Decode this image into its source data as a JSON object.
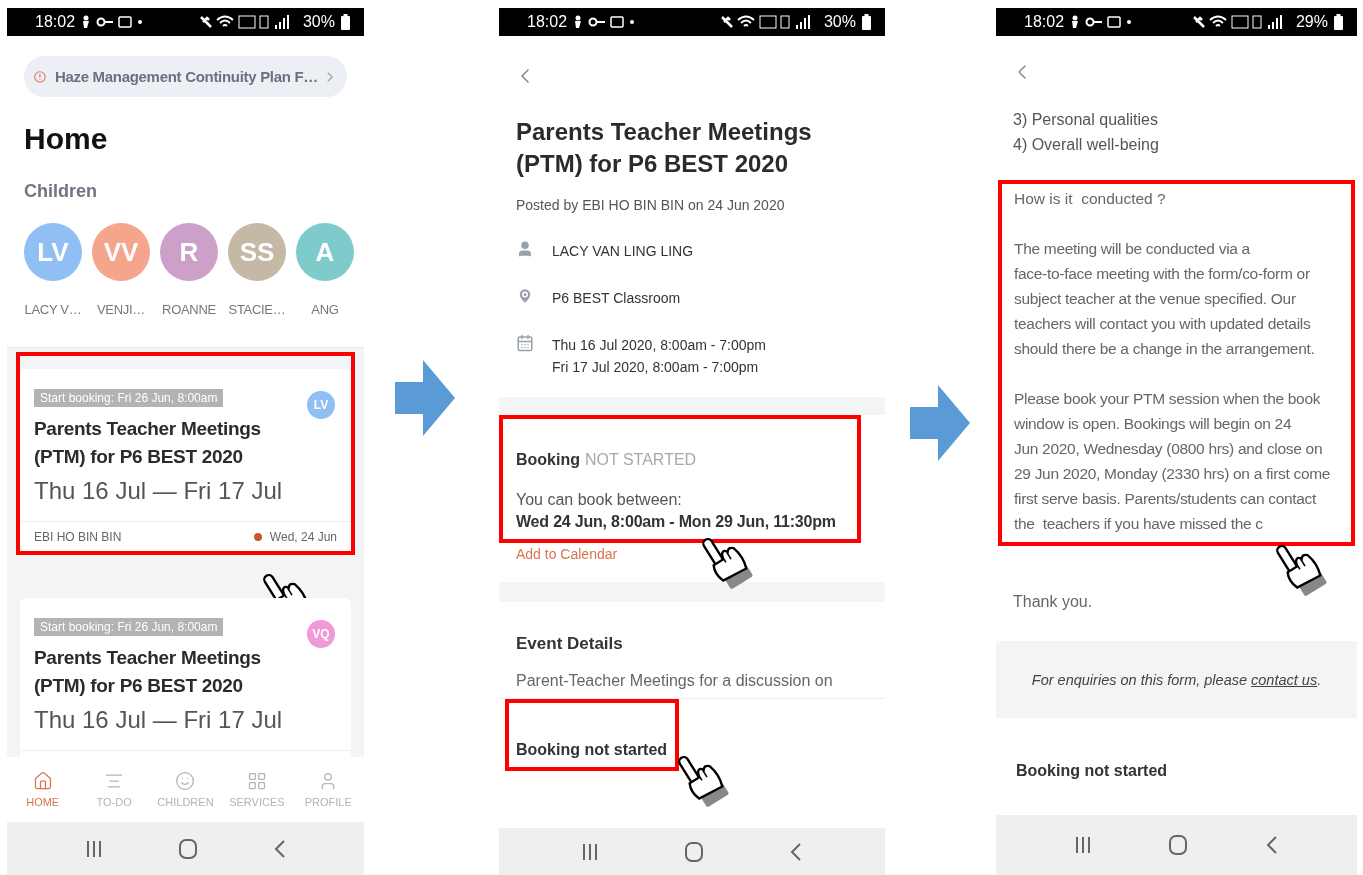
{
  "screens": [
    {
      "kind": "home",
      "status": {
        "time": "18:02",
        "battery": "30%"
      },
      "banner": "Haze Management Continuity Plan F…",
      "title": "Home",
      "children_label": "Children",
      "children": [
        {
          "initials": "LV",
          "name": "LACY V…",
          "color": "#8fbff3"
        },
        {
          "initials": "VV",
          "name": "VENJI…",
          "color": "#f5a58c"
        },
        {
          "initials": "R",
          "name": "ROANNE",
          "color": "#cda0c9"
        },
        {
          "initials": "SS",
          "name": "STACIE…",
          "color": "#c5b8a5"
        },
        {
          "initials": "A",
          "name": "ANG",
          "color": "#7fcbcb"
        }
      ],
      "cards": [
        {
          "highlighted": true,
          "tag": "Start booking: Fri 26 Jun, 8:00am",
          "title": "Parents Teacher Meetings (PTM) for P6 BEST 2020",
          "dates": "Thu 16 Jul — Fri 17 Jul",
          "avatar": "LV",
          "color": "#8fbff3",
          "author": "EBI HO BIN BIN",
          "date": "Wed, 24 Jun"
        },
        {
          "highlighted": false,
          "tag": "Start booking: Fri 26 Jun, 8:00am",
          "title": "Parents Teacher Meetings (PTM) for P6 BEST 2020",
          "dates": "Thu 16 Jul — Fri 17 Jul",
          "avatar": "VQ",
          "color": "#f09ad8"
        }
      ],
      "nav": [
        {
          "label": "HOME",
          "selected": true
        },
        {
          "label": "TO-DO",
          "selected": false
        },
        {
          "label": "CHILDREN",
          "selected": false
        },
        {
          "label": "SERVICES",
          "selected": false
        },
        {
          "label": "PROFILE",
          "selected": false
        }
      ]
    },
    {
      "kind": "detail",
      "status": {
        "time": "18:02",
        "battery": "30%"
      },
      "title": "Parents Teacher Meetings (PTM) for P6 BEST 2020",
      "posted": "Posted by EBI HO BIN BIN on 24 Jun 2020",
      "student": "LACY VAN LING LING",
      "venue": "P6 BEST Classroom",
      "times": [
        "Thu 16 Jul 2020, 8:00am - 7:00pm",
        "Fri 17 Jul 2020, 8:00am - 7:00pm"
      ],
      "booking": {
        "highlighted": true,
        "label": "Booking",
        "status": "NOT STARTED",
        "intro": "You can book between:",
        "window": "Wed 24 Jun, 8:00am - Mon 29 Jun, 11:30pm",
        "calendar_link": "Add to Calendar"
      },
      "event_heading": "Event Details",
      "event_text": "Parent-Teacher Meetings for a discussion on",
      "footer": {
        "highlighted": true,
        "text": "Booking not started"
      }
    },
    {
      "kind": "description",
      "status": {
        "time": "18:02",
        "battery": "29%"
      },
      "intro_lines": [
        "3) Personal qualities",
        "4) Overall well-being"
      ],
      "section": {
        "highlighted": true,
        "heading": "How is it  conducted ?",
        "paragraphs": [
          [
            "The meeting will be conducted via a",
            "face-to-face meeting with the form/co-form or",
            "subject teacher at the venue specified. Our",
            "teachers will contact you with updated details",
            "should there be a change in the arrangement."
          ],
          [
            "Please book your PTM session when the book",
            "window is open. Bookings will begin on 24",
            "Jun 2020, Wednesday (0800 hrs) and close on",
            "29 Jun 2020, Monday (2330 hrs) on a first come",
            "first serve basis. Parents/students can contact",
            "the  teachers if you have missed the c"
          ]
        ]
      },
      "thanks": "Thank you.",
      "enquiry": {
        "text": "For enquiries on this form, please ",
        "link": "contact us",
        "after": "."
      },
      "footer": {
        "highlighted": false,
        "text": "Booking not started"
      }
    }
  ]
}
